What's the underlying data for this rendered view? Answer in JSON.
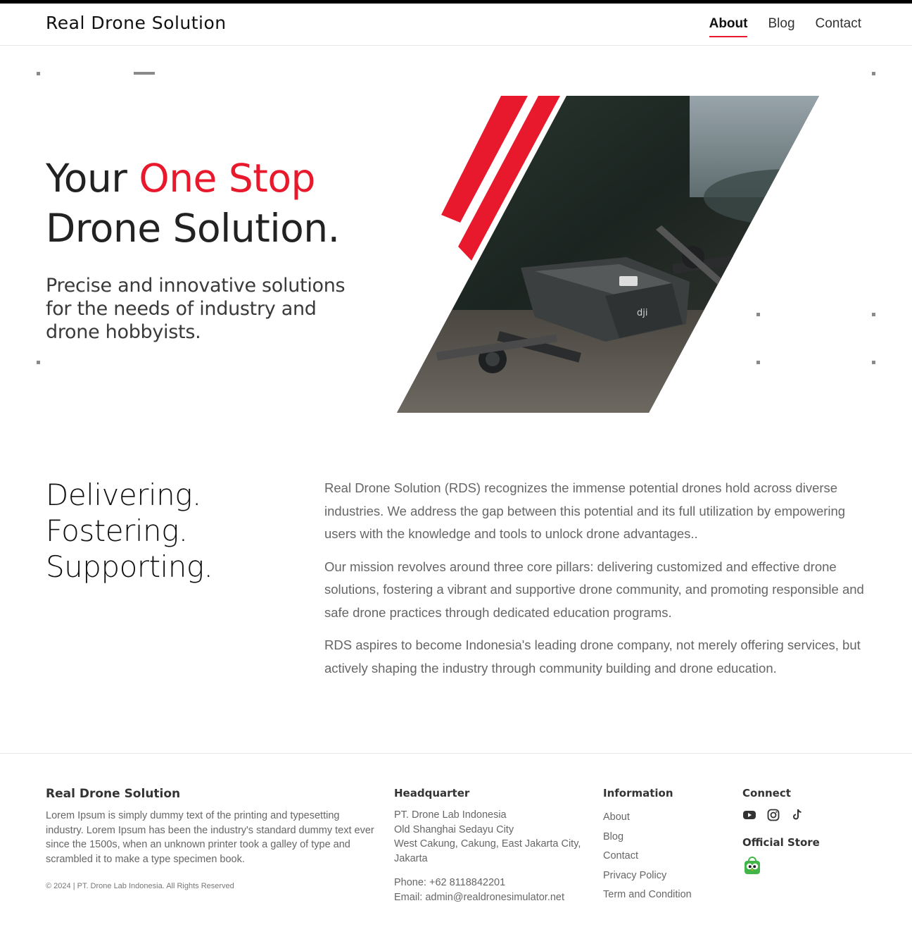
{
  "header": {
    "logo": "Real Drone Solution",
    "nav": [
      {
        "label": "About",
        "active": true
      },
      {
        "label": "Blog",
        "active": false
      },
      {
        "label": "Contact",
        "active": false
      }
    ]
  },
  "hero": {
    "title_line1_pre": "Your ",
    "title_line1_accent": "One Stop",
    "title_line2": "Drone Solution.",
    "subtitle": "Precise and innovative solutions for the needs of industry and drone hobbyists.",
    "accent_color": "#e8192c"
  },
  "pillars": [
    "Delivering.",
    "Fostering.",
    "Supporting."
  ],
  "about": {
    "paragraphs": [
      "Real Drone Solution (RDS) recognizes the immense potential drones hold across diverse industries. We address the gap between this potential and its full utilization by empowering users with the knowledge and tools to unlock drone advantages..",
      "Our mission revolves around three core pillars: delivering customized and effective drone solutions, fostering a vibrant and supportive drone community, and promoting responsible and safe drone practices through dedicated education programs.",
      "RDS aspires to become Indonesia's leading drone company, not merely offering services, but actively shaping the industry through community building and drone education."
    ]
  },
  "footer": {
    "brand": {
      "title": "Real Drone Solution",
      "text": "Lorem Ipsum is simply dummy text of the printing and typesetting industry. Lorem Ipsum has been the industry's standard dummy text ever since the 1500s, when an unknown printer took a galley of type and scrambled it to make a type specimen book.",
      "copyright": "© 2024 | PT. Drone Lab Indonesia. All Rights Reserved"
    },
    "headquarter": {
      "title": "Headquarter",
      "lines": [
        "PT. Drone Lab Indonesia",
        "Old Shanghai Sedayu City",
        "West Cakung, Cakung, East Jakarta City, Jakarta"
      ],
      "phone": "Phone: +62 8118842201",
      "email": "Email: admin@realdronesimulator.net"
    },
    "information": {
      "title": "Information",
      "links": [
        "About",
        "Blog",
        "Contact",
        "Privacy Policy",
        "Term and Condition"
      ]
    },
    "connect": {
      "title": "Connect",
      "icons": [
        "youtube-icon",
        "instagram-icon",
        "tiktok-icon"
      ],
      "store_title": "Official Store",
      "store_icon": "tokopedia-icon"
    }
  }
}
